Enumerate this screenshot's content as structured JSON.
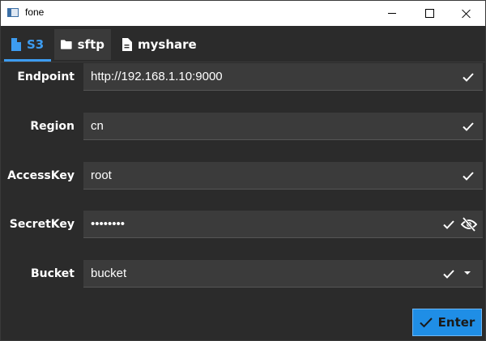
{
  "window": {
    "title": "fone"
  },
  "tabs": [
    {
      "label": "S3",
      "icon": "file-icon",
      "active": true
    },
    {
      "label": "sftp",
      "icon": "folder-icon",
      "active": false
    },
    {
      "label": "myshare",
      "icon": "document-icon",
      "active": false
    }
  ],
  "form": {
    "endpoint": {
      "label": "Endpoint",
      "value": "http://192.168.1.10:9000"
    },
    "region": {
      "label": "Region",
      "value": "cn"
    },
    "access_key": {
      "label": "AccessKey",
      "value": "root"
    },
    "secret_key": {
      "label": "SecretKey",
      "value": "••••••••"
    },
    "bucket": {
      "label": "Bucket",
      "value": "bucket"
    }
  },
  "enter_button": {
    "label": "Enter"
  },
  "colors": {
    "accent": "#3d9cf0",
    "button": "#1f8ee6",
    "background": "#2b2b2b",
    "field": "#3b3b3b"
  }
}
